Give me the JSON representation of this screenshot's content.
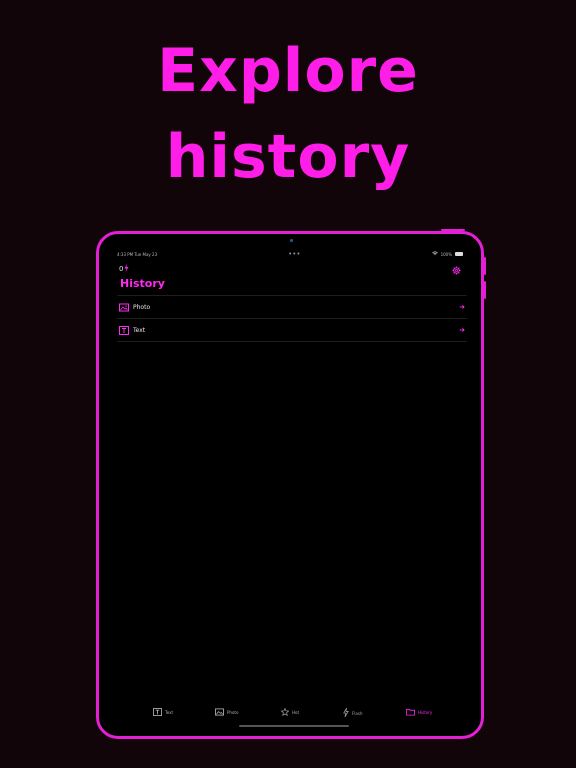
{
  "headline": {
    "line1": "Explore",
    "line2": "history"
  },
  "status_bar": {
    "time": "4:33 PM",
    "date": "Tue May 23",
    "battery": "100%"
  },
  "top_bar": {
    "counter": "0"
  },
  "page_title": "History",
  "history_items": [
    {
      "label": "Photo",
      "icon": "photo-icon"
    },
    {
      "label": "Text",
      "icon": "text-icon"
    }
  ],
  "tabs": [
    {
      "label": "Text",
      "icon": "text-icon",
      "active": false
    },
    {
      "label": "Photo",
      "icon": "photo-icon",
      "active": false
    },
    {
      "label": "Hot",
      "icon": "star-icon",
      "active": false
    },
    {
      "label": "Flash",
      "icon": "bolt-icon",
      "active": false
    },
    {
      "label": "History",
      "icon": "folder-icon",
      "active": true
    }
  ],
  "colors": {
    "accent": "#ff2af0",
    "frame": "#e41fd6",
    "background": "#120509",
    "screen": "#000000"
  }
}
